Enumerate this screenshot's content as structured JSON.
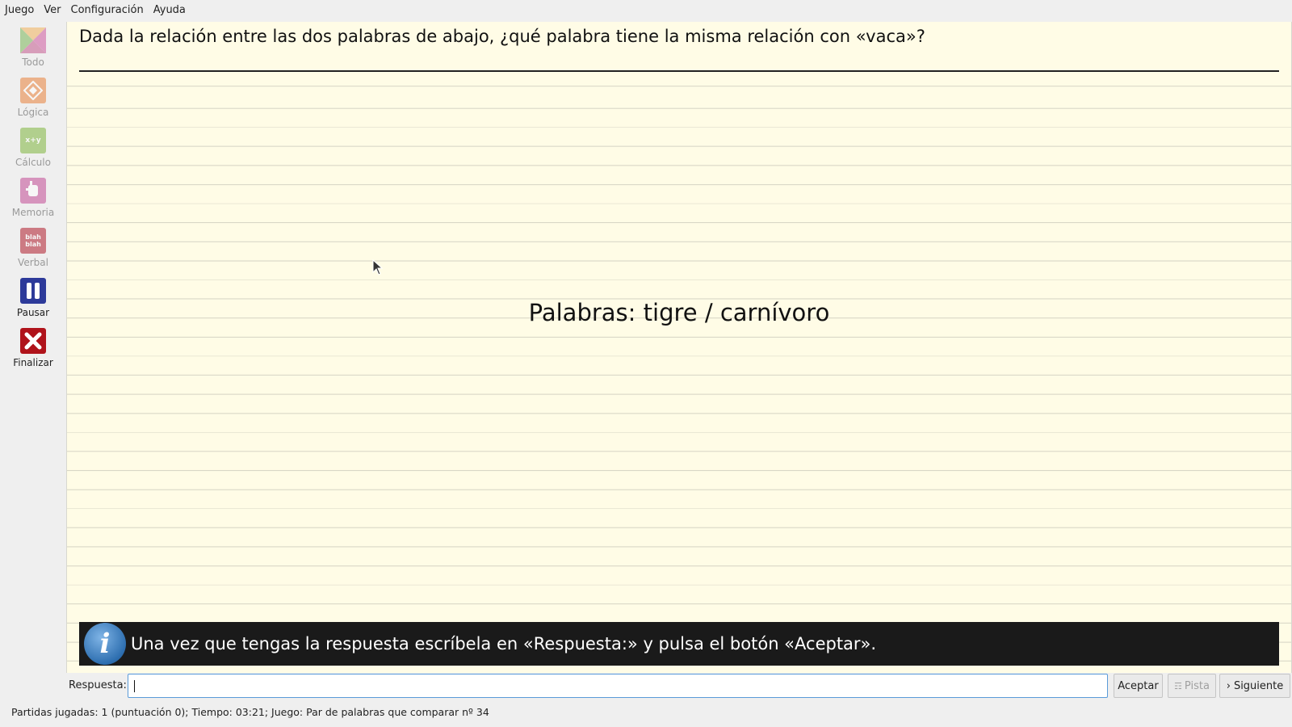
{
  "menu": {
    "items": [
      "Juego",
      "Ver",
      "Configuración",
      "Ayuda"
    ]
  },
  "toolbar": {
    "todo": "Todo",
    "logica": "Lógica",
    "calculo": "Cálculo",
    "memoria": "Memoria",
    "verbal": "Verbal",
    "pausar": "Pausar",
    "finalizar": "Finalizar",
    "calc_icon_text": "x+y",
    "verbal_icon_text": "blah blah"
  },
  "game": {
    "question": "Dada la relación entre las dos palabras de abajo, ¿qué palabra tiene la misma relación con «vaca»?",
    "words": "Palabras: tigre / carnívoro",
    "info": "Una vez que tengas la respuesta escríbela en «Respuesta:» y pulsa el botón «Aceptar»."
  },
  "answer": {
    "label": "Respuesta:",
    "value": "",
    "accept": "Aceptar",
    "hint": "Pista",
    "next": "Siguiente"
  },
  "status": {
    "text": "Partidas jugadas: 1 (puntuación 0); Tiempo: 03:21; Juego: Par de palabras que comparar nº 34"
  },
  "colors": {
    "paper": "#fffce6",
    "pause": "#2d3a9a",
    "finish": "#b0131b",
    "infobar": "#1a1a1a"
  }
}
